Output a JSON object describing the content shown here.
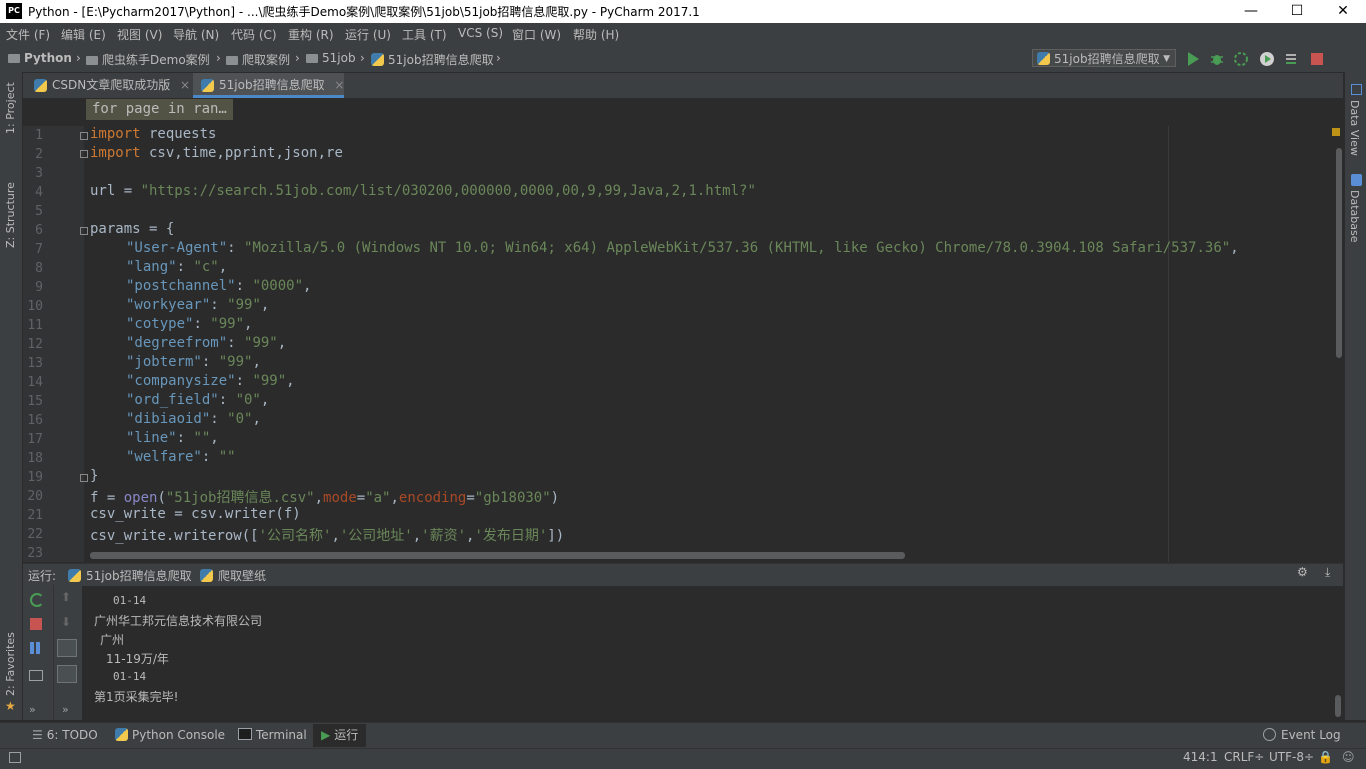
{
  "window": {
    "title": "Python - [E:\\Pycharm2017\\Python] - ...\\爬虫练手Demo案例\\爬取案例\\51job\\51job招聘信息爬取.py - PyCharm 2017.1",
    "app_icon": "PC",
    "minimize": "—",
    "maximize": "☐",
    "close": "✕"
  },
  "menu": [
    "文件 (F)",
    "编辑 (E)",
    "视图 (V)",
    "导航 (N)",
    "代码 (C)",
    "重构 (R)",
    "运行 (U)",
    "工具 (T)",
    "VCS (S)",
    "窗口 (W)",
    "帮助 (H)"
  ],
  "breadcrumb": [
    "Python",
    "爬虫练手Demo案例",
    "爬取案例",
    "51job",
    "51job招聘信息爬取"
  ],
  "run_config": {
    "label": "51job招聘信息爬取",
    "arrow": "▼"
  },
  "left_stripe": {
    "project": "1: Project",
    "structure": "Z: Structure",
    "favorites": "2: Favorites"
  },
  "right_stripe": {
    "data_view": "Data View",
    "database": "Database"
  },
  "editor_tabs": [
    {
      "label": "CSDN文章爬取成功版",
      "close": "×"
    },
    {
      "label": "51job招聘信息爬取",
      "close": "×"
    }
  ],
  "hint": "for page in ran…",
  "code": {
    "line_numbers": [
      "1",
      "2",
      "3",
      "4",
      "5",
      "6",
      "7",
      "8",
      "9",
      "10",
      "11",
      "12",
      "13",
      "14",
      "15",
      "16",
      "17",
      "18",
      "19",
      "20",
      "21",
      "22",
      "23"
    ],
    "l1_kw": "import",
    "l1_rest": " requests",
    "l2_kw": "import",
    "l2_rest": " csv,time,pprint,json,re",
    "l4_a": "url = ",
    "l4_s": "\"https://search.51job.com/list/030200,000000,0000,00,9,99,Java,2,1.html?\"",
    "l6": "params = {",
    "l7_k": "\"User-Agent\"",
    "l7_s": "\"Mozilla/5.0 (Windows NT 10.0; Win64; x64) AppleWebKit/537.36 (KHTML, like Gecko) Chrome/78.0.3904.108 Safari/537.36\"",
    "l8_k": "\"lang\"",
    "l8_s": "\"c\"",
    "l9_k": "\"postchannel\"",
    "l9_s": "\"0000\"",
    "l10_k": "\"workyear\"",
    "l10_s": "\"99\"",
    "l11_k": "\"cotype\"",
    "l11_s": "\"99\"",
    "l12_k": "\"degreefrom\"",
    "l12_s": "\"99\"",
    "l13_k": "\"jobterm\"",
    "l13_s": "\"99\"",
    "l14_k": "\"companysize\"",
    "l14_s": "\"99\"",
    "l15_k": "\"ord_field\"",
    "l15_s": "\"0\"",
    "l16_k": "\"dibiaoid\"",
    "l16_s": "\"0\"",
    "l17_k": "\"line\"",
    "l17_s": "\"\"",
    "l18_k": "\"welfare\"",
    "l18_s": "\"\"",
    "l19": "}",
    "l20_a": "f = ",
    "l20_fn": "open",
    "l20_b": "(",
    "l20_s1": "\"51job招聘信息.csv\"",
    "l20_c": ",",
    "l20_p1": "mode",
    "l20_d": "=",
    "l20_s2": "\"a\"",
    "l20_e": ",",
    "l20_p2": "encoding",
    "l20_f": "=",
    "l20_s3": "\"gb18030\"",
    "l20_g": ")",
    "l21": "csv_write = csv.writer(f)",
    "l22_a": "csv_write.writerow([",
    "l22_s1": "'公司名称'",
    "l22_c1": ",",
    "l22_s2": "'公司地址'",
    "l22_c2": ",",
    "l22_s3": "'薪资'",
    "l22_c3": ",",
    "l22_s4": "'发布日期'",
    "l22_b": "])",
    "colon": ": ",
    "comma": ","
  },
  "run_panel": {
    "label": "运行:",
    "tabs": [
      "51job招聘信息爬取",
      "爬取壁纸"
    ],
    "output": [
      "01-14",
      "广州华工邦元信息技术有限公司",
      "广州",
      "11-19万/年",
      "01-14",
      "第1页采集完毕!"
    ]
  },
  "tool_windows": [
    "6: TODO",
    "Python Console",
    "Terminal",
    "运行",
    "Event Log"
  ],
  "status": {
    "position": "414:1",
    "line_sep": "CRLF÷",
    "encoding": "UTF-8÷"
  },
  "colors": {
    "background": "#2b2b2b",
    "panel": "#3c3f41",
    "keyword": "#cc7832",
    "string": "#6a8759",
    "dict_key": "#6897bb",
    "builtin": "#8888c6",
    "param": "#aa4926"
  }
}
